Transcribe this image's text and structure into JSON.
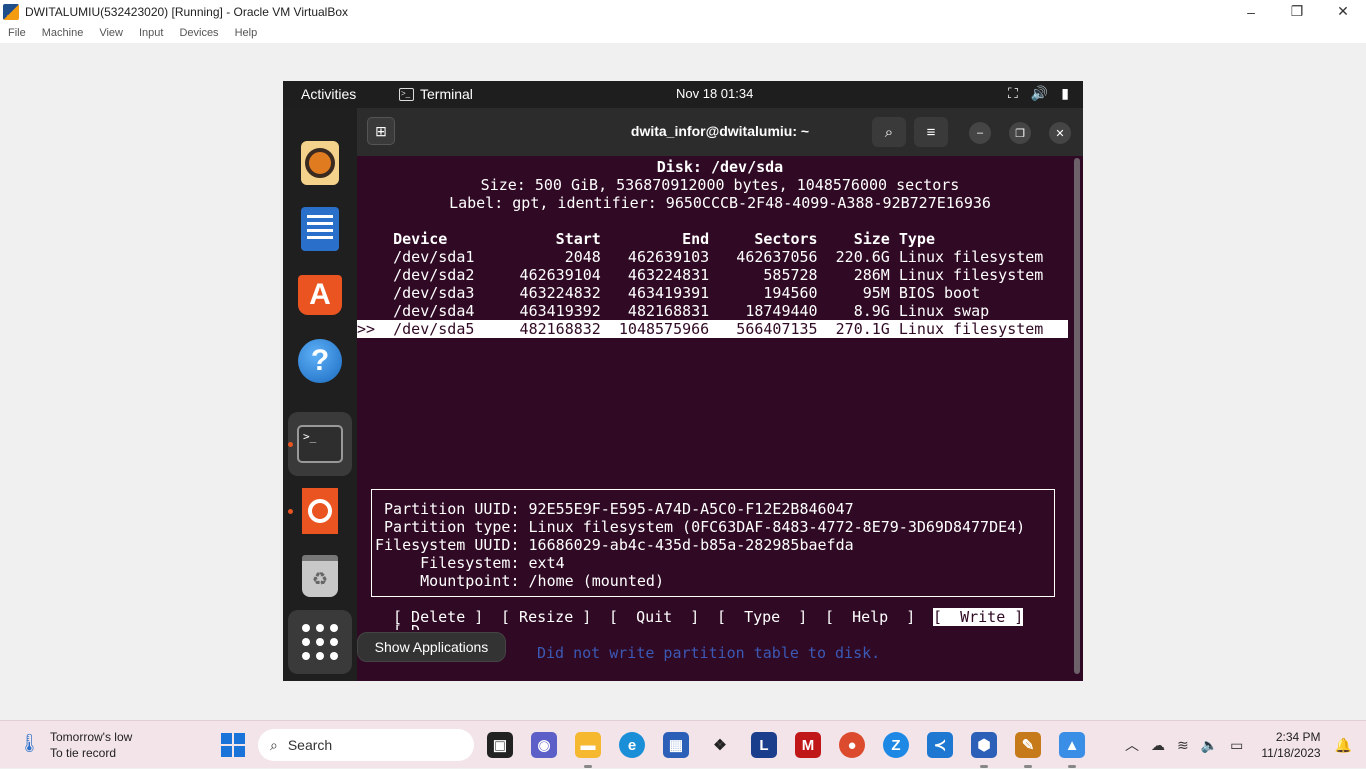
{
  "host": {
    "window_title": "DWITALUMIU(532423020) [Running] - Oracle VM VirtualBox",
    "controls": [
      "–",
      "❐",
      "✕"
    ],
    "menu": [
      "File",
      "Machine",
      "View",
      "Input",
      "Devices",
      "Help"
    ]
  },
  "guest_topbar": {
    "activities": "Activities",
    "app_name": "Terminal",
    "clock": "Nov 18  01:34",
    "icons": [
      "network-icon",
      "volume-icon",
      "battery-icon"
    ]
  },
  "dock": {
    "items": [
      "rhythmbox",
      "libreoffice-writer",
      "ubuntu-software",
      "help",
      "terminal",
      "ubuntu-installer",
      "trash",
      "show-applications"
    ],
    "tooltip": "Show Applications"
  },
  "terminal": {
    "title": "dwita_infor@dwitalumiu: ~",
    "disk_header": "Disk: /dev/sda",
    "size_line": "Size: 500 GiB, 536870912000 bytes, 1048576000 sectors",
    "label_line": "Label: gpt, identifier: 9650CCCB-2F48-4099-A388-92B727E16936",
    "table_header": "    Device            Start         End     Sectors    Size Type",
    "rows": [
      "    /dev/sda1          2048   462639103   462637056  220.6G Linux filesystem",
      "    /dev/sda2     462639104   463224831      585728    286M Linux filesystem",
      "    /dev/sda3     463224832   463419391      194560     95M BIOS boot",
      "    /dev/sda4     463419392   482168831    18749440    8.9G Linux swap",
      ">>  /dev/sda5     482168832  1048575966   566407135  270.1G Linux filesystem "
    ],
    "info": [
      " Partition UUID: 92E55E9F-E595-A74D-A5C0-F12E2B846047",
      " Partition type: Linux filesystem (0FC63DAF-8483-4772-8E79-3D69D8477DE4)",
      "Filesystem UUID: 16686029-ab4c-435d-b85a-282985baefda",
      "     Filesystem: ext4",
      "     Mountpoint: /home (mounted)"
    ],
    "menu_buttons": [
      "[ Delete ]",
      "[ Resize ]",
      "[  Quit  ]",
      "[  Type  ]",
      "[  Help  ]",
      "[  Write ]"
    ],
    "menu_overflow": "[ D",
    "menu_overflow_tail": "p ]",
    "status": "Did not write partition table to disk."
  },
  "taskbar": {
    "weather_line1": "Tomorrow's low",
    "weather_line2": "To tie record",
    "search_placeholder": "Search",
    "time": "2:34 PM",
    "date": "11/18/2023"
  }
}
